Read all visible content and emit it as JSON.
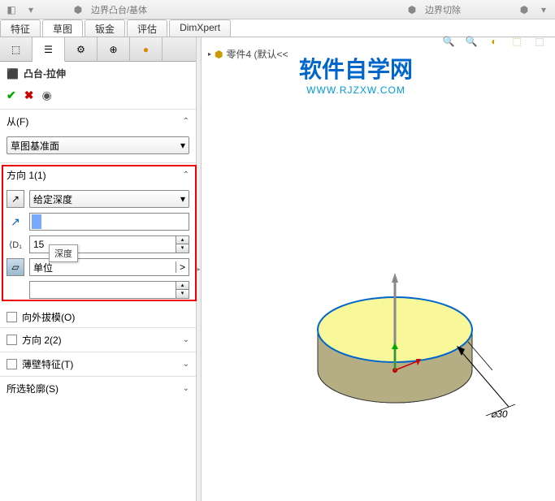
{
  "toolbar": {
    "boss": "边界凸台/基体",
    "cut": "边界切除"
  },
  "tabs": [
    "特征",
    "草图",
    "钣金",
    "评估",
    "DimXpert"
  ],
  "active_tab": 1,
  "feature": {
    "title": "凸台-拉伸"
  },
  "sections": {
    "from": {
      "label": "从(F)",
      "value": "草图基准面"
    },
    "dir1": {
      "label": "方向 1(1)",
      "type": "给定深度",
      "depth_input": "15",
      "depth_tooltip": "深度",
      "unit": "单位",
      "draft": "向外拔模(O)"
    },
    "dir2": {
      "label": "方向 2(2)"
    },
    "thin": {
      "label": "薄壁特征(T)"
    },
    "contour": {
      "label": "所选轮廓(S)"
    }
  },
  "viewport": {
    "tree_item": "零件4 (默认<<",
    "watermark_cn": "软件自学网",
    "watermark_en": "WWW.RJZXW.COM",
    "dimension": "⌀30"
  }
}
